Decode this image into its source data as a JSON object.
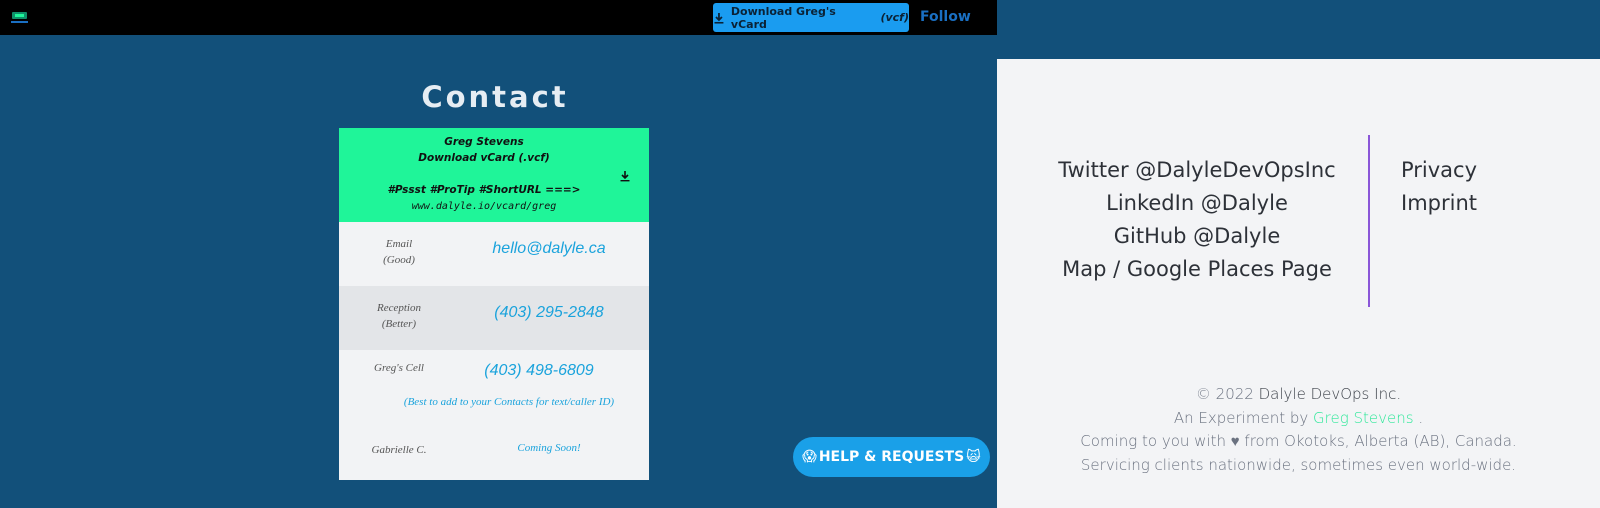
{
  "topbar": {
    "download_label": "Download Greg's vCard",
    "download_suffix": "(vcf)",
    "follow_label": "Follow"
  },
  "contact": {
    "title": "Contact",
    "card_head": {
      "name": "Greg Stevens",
      "download": "Download vCard (.vcf)",
      "protip": "#Pssst #ProTip #ShortURL ===>",
      "short_url": "www.dalyle.io/vcard/greg"
    },
    "rows": [
      {
        "label_line1": "Email",
        "label_line2": "(Good)",
        "value": "hello@dalyle.ca"
      },
      {
        "label_line1": "Reception",
        "label_line2": "(Better)",
        "value": "(403) 295-2848"
      },
      {
        "label_line1": "Greg's Cell",
        "value": "(403) 498-6809",
        "note": "(Best to add to your Contacts for text/caller ID)"
      },
      {
        "label_line1": "Gabrielle C.",
        "value": "Coming Soon!"
      }
    ]
  },
  "help_button": {
    "emoji_left": "😱",
    "label": "HELP & REQUESTS",
    "emoji_right": "🙀"
  },
  "social_links": [
    "Twitter @DalyleDevOpsInc",
    "LinkedIn @Dalyle",
    "GitHub @Dalyle",
    "Map / Google Places Page"
  ],
  "legal_links": [
    "Privacy",
    "Imprint"
  ],
  "footer": {
    "copyright": "© 2022",
    "company": "Dalyle DevOps Inc.",
    "experiment_prefix": "An Experiment by",
    "experiment_name": "Greg Stevens",
    "experiment_suffix": ".",
    "line3": "Coming to you with ♥ from Okotoks, Alberta (AB), Canada.",
    "line4": "Servicing clients nationwide, sometimes even world-wide."
  },
  "colors": {
    "brand_blue": "#12507a",
    "accent_green": "#1ff599",
    "link_blue": "#1ba3dc",
    "divider_purple": "#8a56d8"
  }
}
